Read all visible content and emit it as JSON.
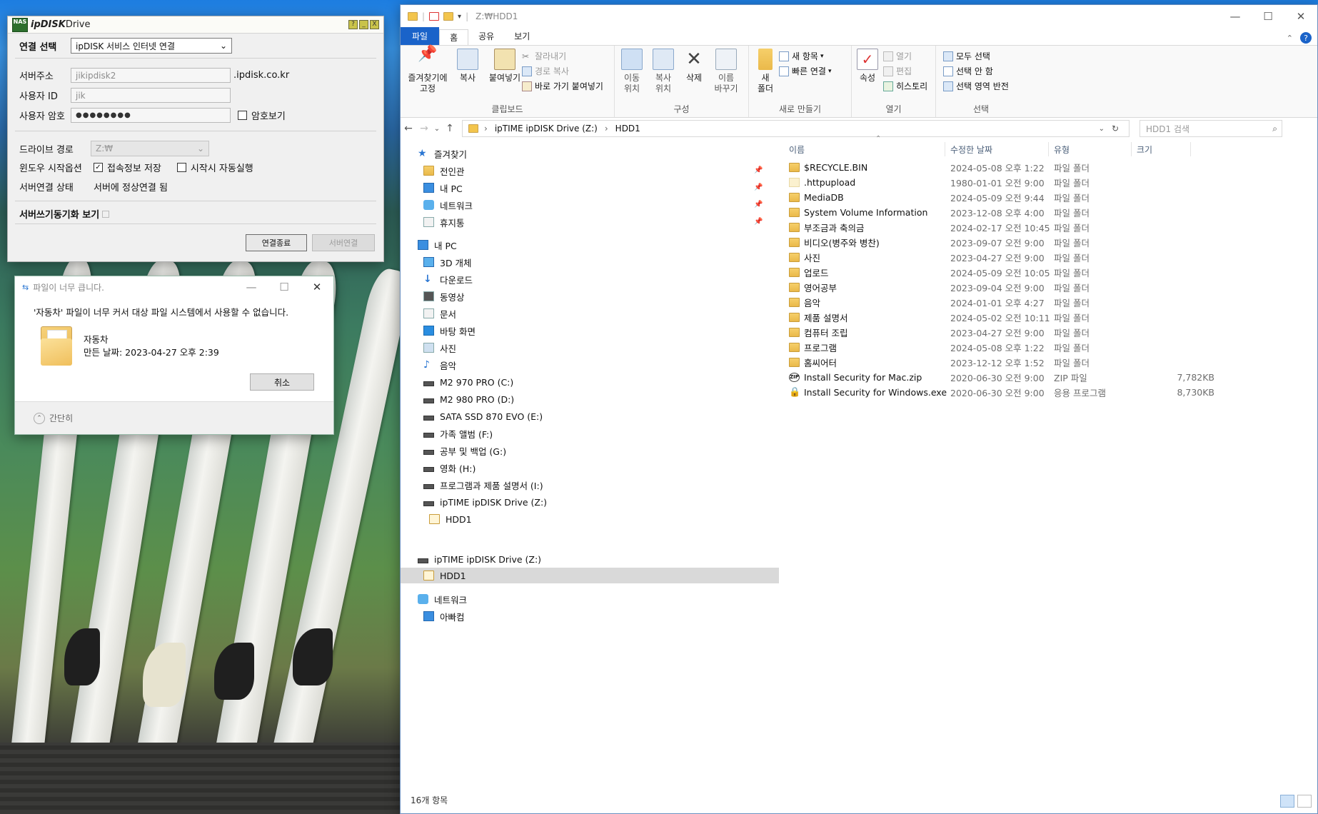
{
  "ipdisk": {
    "logo_badge": "NAS",
    "logo_main": "ipDISK",
    "logo_sub": "Drive",
    "title_buttons": [
      "?",
      "_",
      "X"
    ],
    "conn_select_label": "연결 선택",
    "conn_select_value": "ipDISK 서비스 인터넷 연결",
    "server_addr_label": "서버주소",
    "server_addr_value": "jikipdisk2",
    "domain_suffix": ".ipdisk.co.kr",
    "user_id_label": "사용자 ID",
    "user_id_value": "jik",
    "password_label": "사용자 암호",
    "password_value": "●●●●●●●●",
    "show_password_label": "암호보기",
    "drive_path_label": "드라이브 경로",
    "drive_path_value": "Z:₩",
    "windows_start_label": "윈도우 시작옵션",
    "save_conn_label": "접속정보 저장",
    "save_conn_checked": true,
    "autorun_label": "시작시 자동실행",
    "autorun_checked": false,
    "server_status_label": "서버연결 상태",
    "server_status_value": "서버에 정상연결 됨",
    "sync_label": "서버쓰기동기화 보기",
    "disconnect_button": "연결종료",
    "connect_button": "서버연결"
  },
  "error_dialog": {
    "title": "파일이 너무 큽니다.",
    "message": "'자동차' 파일이 너무 커서 대상 파일 시스템에서 사용할 수 없습니다.",
    "file_name": "자동차",
    "created_label": "만든 날짜: 2023-04-27 오후 2:39",
    "cancel_button": "취소",
    "less_detail": "간단히"
  },
  "explorer": {
    "title": "Z:₩HDD1",
    "tabs": [
      "파일",
      "홈",
      "공유",
      "보기"
    ],
    "ribbon": {
      "pin_quick": "즐겨찾기에\n고정",
      "copy": "복사",
      "paste": "붙여넣기",
      "cut": "잘라내기",
      "copy_path": "경로 복사",
      "paste_shortcut": "바로 가기 붙여넣기",
      "clipboard_group": "클립보드",
      "move_to": "이동\n위치",
      "copy_to": "복사\n위치",
      "delete": "삭제",
      "rename": "이름\n바꾸기",
      "organize_group": "구성",
      "new_folder": "새\n폴더",
      "new_item": "새 항목",
      "easy_access": "빠른 연결",
      "new_group": "새로 만들기",
      "properties": "속성",
      "open": "열기",
      "edit": "편집",
      "history": "히스토리",
      "open_group": "열기",
      "select_all": "모두 선택",
      "select_none": "선택 안 함",
      "invert_select": "선택 영역 반전",
      "select_group": "선택"
    },
    "breadcrumb": [
      "ipTIME ipDISK Drive (Z:)",
      "HDD1"
    ],
    "search_placeholder": "HDD1 검색",
    "nav": {
      "quick_access": "즐겨찾기",
      "pinned": [
        "전인관",
        "내 PC",
        "네트워크",
        "휴지통"
      ],
      "this_pc": "내 PC",
      "pc_items": [
        "3D 개체",
        "다운로드",
        "동영상",
        "문서",
        "바탕 화면",
        "사진",
        "음악"
      ],
      "drives": [
        "M2 970 PRO (C:)",
        "M2 980 PRO (D:)",
        "SATA SSD 870 EVO (E:)",
        "가족 앨범 (F:)",
        "공부 및 백업 (G:)",
        "영화 (H:)",
        "프로그램과 제품 설명서 (I:)",
        "ipTIME ipDISK Drive (Z:)"
      ],
      "sub_hdd": "HDD1",
      "drive_z": "ipTIME ipDISK Drive (Z:)",
      "drive_z_hdd": "HDD1",
      "network": "네트워크",
      "network_pc": "아빠컴"
    },
    "columns": [
      "이름",
      "수정한 날짜",
      "유형",
      "크기"
    ],
    "files": [
      {
        "name": "$RECYCLE.BIN",
        "date": "2024-05-08 오후 1:22",
        "type": "파일 폴더",
        "size": "",
        "icon": "folder"
      },
      {
        "name": ".httpupload",
        "date": "1980-01-01 오전 9:00",
        "type": "파일 폴더",
        "size": "",
        "icon": "folder-light"
      },
      {
        "name": "MediaDB",
        "date": "2024-05-09 오전 9:44",
        "type": "파일 폴더",
        "size": "",
        "icon": "folder"
      },
      {
        "name": "System Volume Information",
        "date": "2023-12-08 오후 4:00",
        "type": "파일 폴더",
        "size": "",
        "icon": "folder"
      },
      {
        "name": "부조금과 축의금",
        "date": "2024-02-17 오전 10:45",
        "type": "파일 폴더",
        "size": "",
        "icon": "folder"
      },
      {
        "name": "비디오(병주와 병찬)",
        "date": "2023-09-07 오전 9:00",
        "type": "파일 폴더",
        "size": "",
        "icon": "folder"
      },
      {
        "name": "사진",
        "date": "2023-04-27 오전 9:00",
        "type": "파일 폴더",
        "size": "",
        "icon": "folder"
      },
      {
        "name": "업로드",
        "date": "2024-05-09 오전 10:05",
        "type": "파일 폴더",
        "size": "",
        "icon": "folder"
      },
      {
        "name": "영어공부",
        "date": "2023-09-04 오전 9:00",
        "type": "파일 폴더",
        "size": "",
        "icon": "folder"
      },
      {
        "name": "음악",
        "date": "2024-01-01 오후 4:27",
        "type": "파일 폴더",
        "size": "",
        "icon": "folder"
      },
      {
        "name": "제품 설명서",
        "date": "2024-05-02 오전 10:11",
        "type": "파일 폴더",
        "size": "",
        "icon": "folder"
      },
      {
        "name": "컴퓨터 조립",
        "date": "2023-04-27 오전 9:00",
        "type": "파일 폴더",
        "size": "",
        "icon": "folder"
      },
      {
        "name": "프로그램",
        "date": "2024-05-08 오후 1:22",
        "type": "파일 폴더",
        "size": "",
        "icon": "folder"
      },
      {
        "name": "홈씨어터",
        "date": "2023-12-12 오후 1:52",
        "type": "파일 폴더",
        "size": "",
        "icon": "folder"
      },
      {
        "name": "Install Security for Mac.zip",
        "date": "2020-06-30 오전 9:00",
        "type": "ZIP 파일",
        "size": "7,782KB",
        "icon": "zip"
      },
      {
        "name": "Install Security for Windows.exe",
        "date": "2020-06-30 오전 9:00",
        "type": "응용 프로그램",
        "size": "8,730KB",
        "icon": "exe"
      }
    ],
    "status": "16개 항목"
  }
}
